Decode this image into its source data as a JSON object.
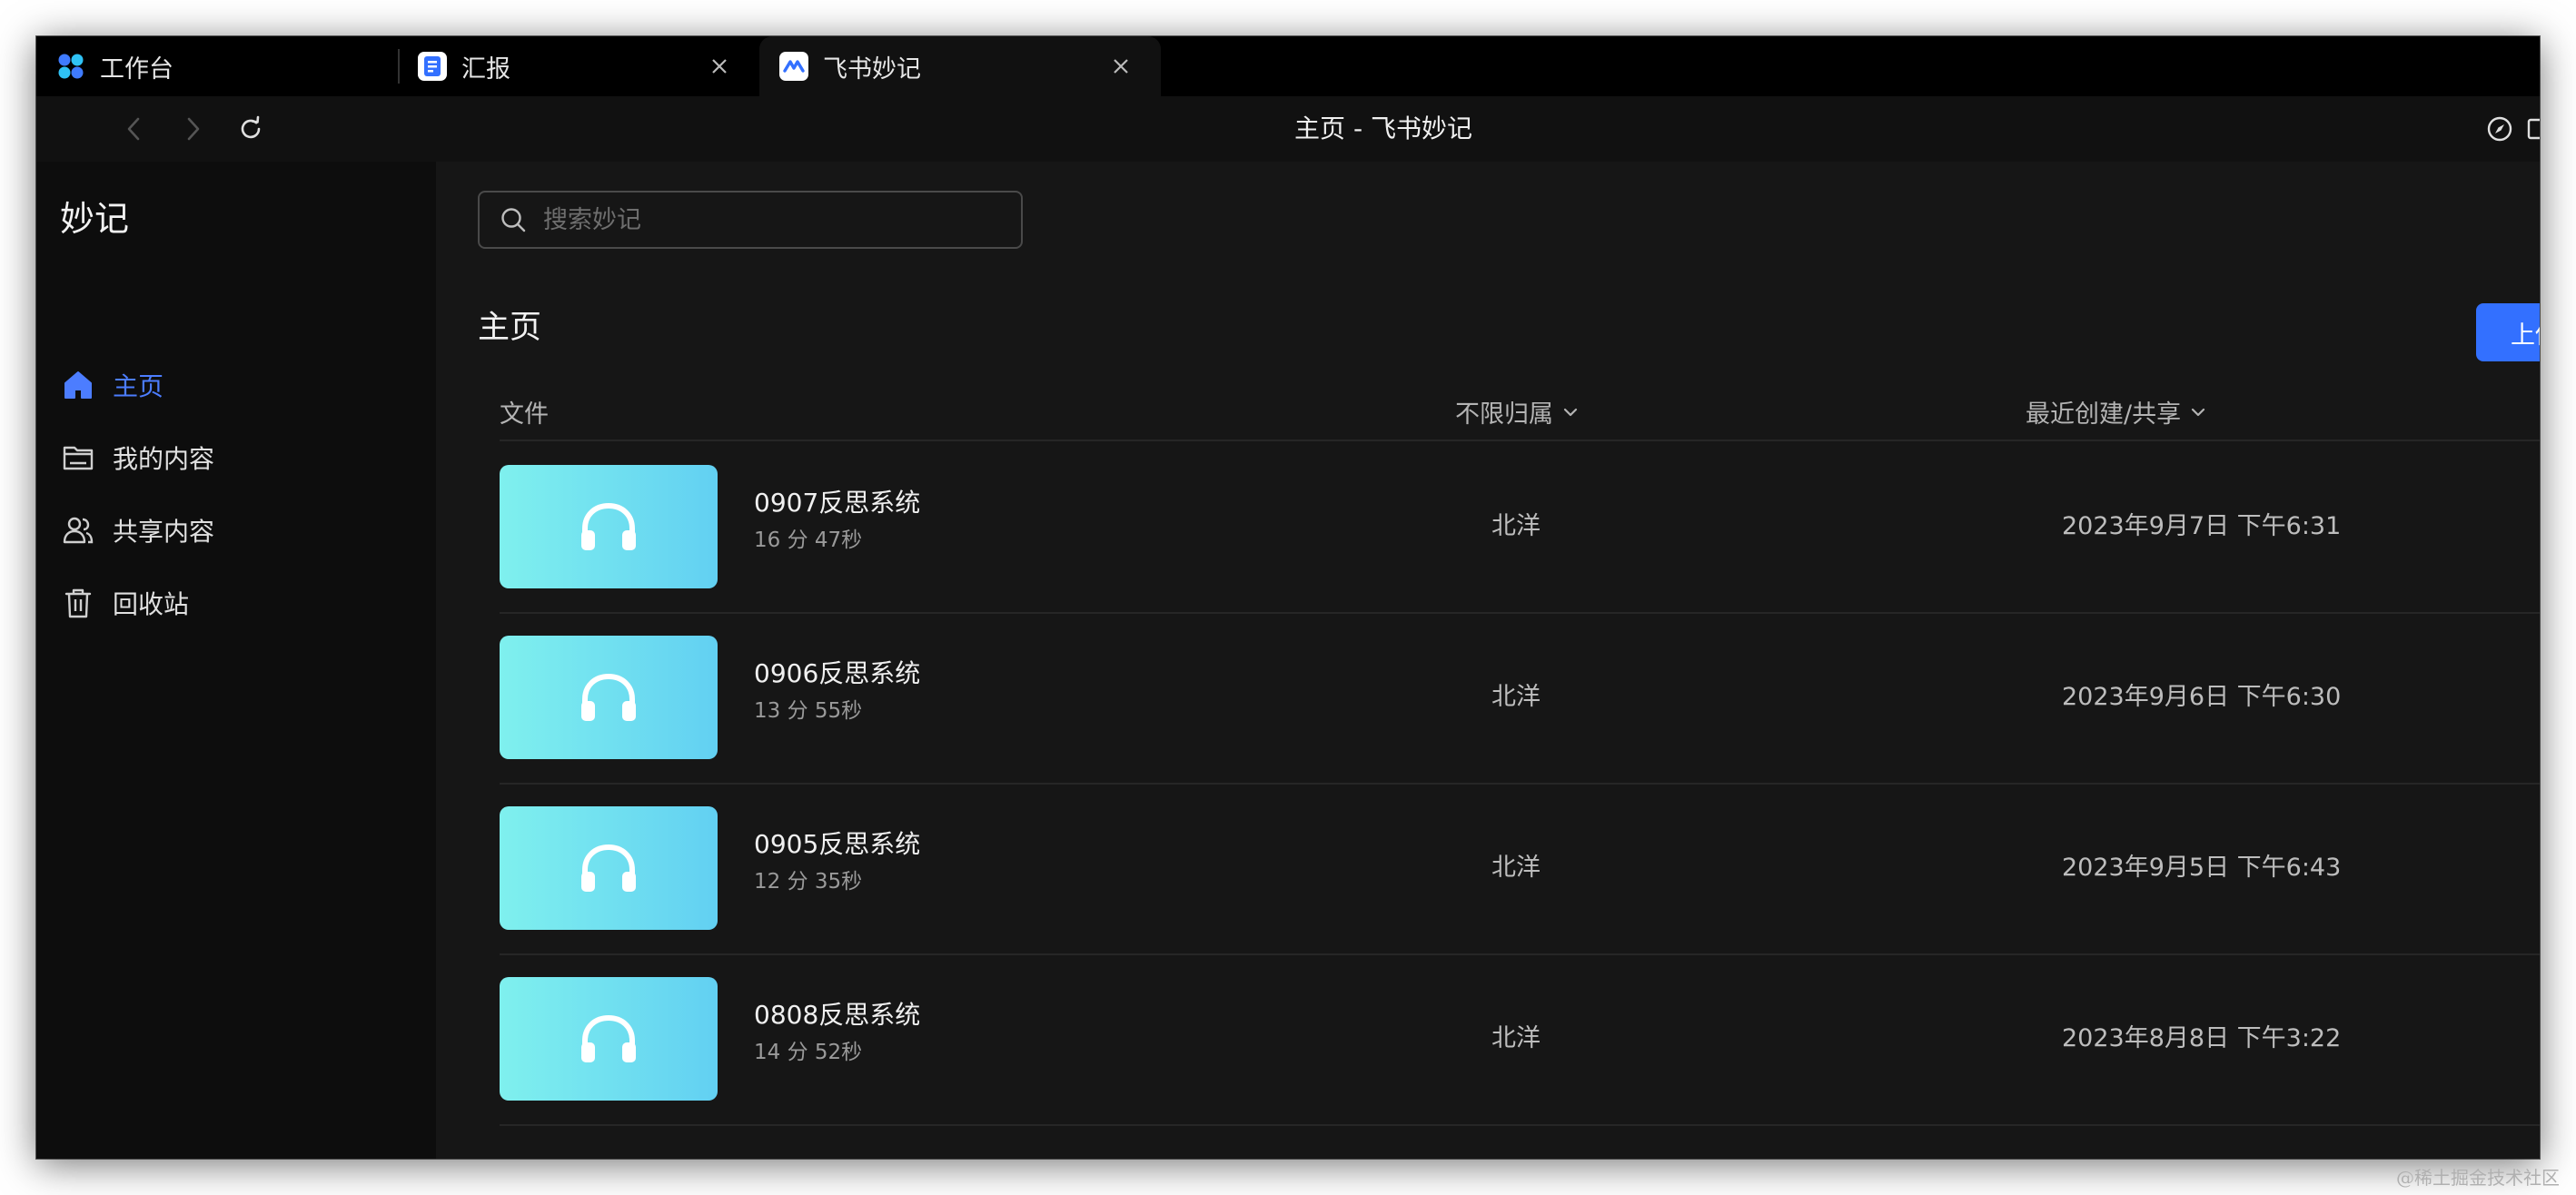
{
  "tabs": [
    {
      "label": "工作台",
      "icon": "grid-icon",
      "closable": false
    },
    {
      "label": "汇报",
      "icon": "report-icon",
      "closable": true
    },
    {
      "label": "飞书妙记",
      "icon": "minutes-icon",
      "closable": true,
      "active": true
    }
  ],
  "toolbar": {
    "title": "主页 - 飞书妙记"
  },
  "sidebar": {
    "app_title": "妙记",
    "items": [
      {
        "label": "主页",
        "icon": "home-icon",
        "active": true
      },
      {
        "label": "我的内容",
        "icon": "folder-icon"
      },
      {
        "label": "共享内容",
        "icon": "users-icon"
      },
      {
        "label": "回收站",
        "icon": "trash-icon"
      }
    ]
  },
  "main": {
    "search_placeholder": "搜索妙记",
    "page_title": "主页",
    "upload_label": "上传",
    "columns": {
      "file": "文件",
      "owner": "不限归属",
      "recent": "最近创建/共享"
    },
    "rows": [
      {
        "title": "0907反思系统",
        "duration": "16 分 47秒",
        "owner": "北洋",
        "date": "2023年9月7日 下午6:31"
      },
      {
        "title": "0906反思系统",
        "duration": "13 分 55秒",
        "owner": "北洋",
        "date": "2023年9月6日 下午6:30"
      },
      {
        "title": "0905反思系统",
        "duration": "12 分 35秒",
        "owner": "北洋",
        "date": "2023年9月5日 下午6:43"
      },
      {
        "title": "0808反思系统",
        "duration": "14 分 52秒",
        "owner": "北洋",
        "date": "2023年8月8日 下午3:22"
      }
    ]
  },
  "watermark": "@稀土掘金技术社区",
  "colors": {
    "accent": "#3370ff",
    "active_nav": "#4c7dff",
    "thumb_start": "#7ff0ee",
    "thumb_end": "#62d0f2"
  }
}
